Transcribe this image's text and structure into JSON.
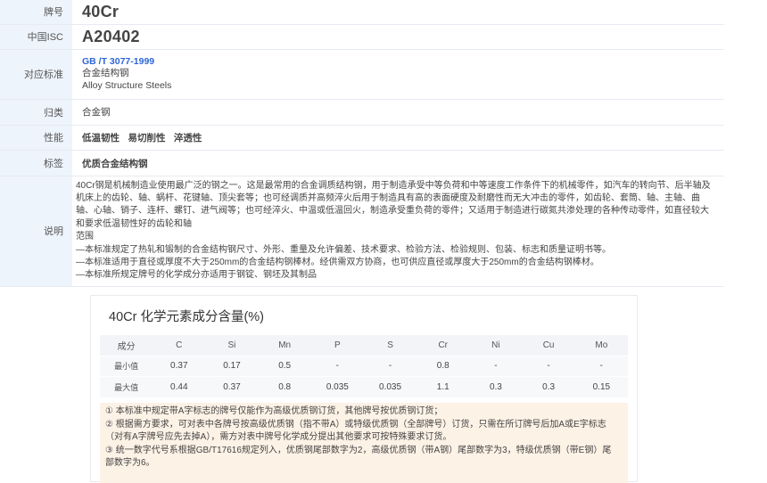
{
  "spec": {
    "grade_label": "牌号",
    "grade_value": "40Cr",
    "isc_label": "中国ISC",
    "isc_value": "A20402",
    "standard_label": "对应标准",
    "standard_code": "GB /T 3077-1999",
    "standard_cn": "合金结构钢",
    "standard_en": "Alloy Structure Steels",
    "category_label": "归类",
    "category_value": "合金钢",
    "property_label": "性能",
    "properties": [
      "低温韧性",
      "易切削性",
      "淬透性"
    ],
    "tag_label": "标签",
    "tags": [
      "优质合金结构钢"
    ],
    "desc_label": "说明",
    "desc_lines": [
      "40Cr钢是机械制造业使用最广泛的钢之一。这是最常用的合金调质结构钢，用于制造承受中等负荷和中等速度工作条件下的机械零件，如汽车的转向节、后半轴及",
      "机床上的齿轮、轴、蜗杆、花键轴、顶尖套等；也可经调质并高频淬火后用于制造具有高的表面硬度及耐磨性而无大冲击的零件，如齿轮、套筒、轴、主轴、曲",
      "轴、心轴、销子、连杆、螺钉、进气阀等；也可经淬火、中温或低温回火，制造承受重负荷的零件；又适用于制造进行碳氮共渗处理的各种传动零件，如直径较大",
      "和要求低温韧性好的齿轮和轴",
      "范围",
      "—本标准规定了热轧和锻制的合金结构钢尺寸、外形、重量及允许偏差、技术要求、检验方法、检验规则、包装、标志和质量证明书等。",
      "—本标准适用于直径或厚度不大于250mm的合金结构钢棒材。经供需双方协商，也可供应直径或厚度大于250mm的合金结构钢棒材。",
      "—本标准所规定牌号的化学成分亦适用于钢锭、钢坯及其制品"
    ]
  },
  "composition": {
    "title": "40Cr 化学元素成分含量(%)",
    "header": [
      "成分",
      "C",
      "Si",
      "Mn",
      "P",
      "S",
      "Cr",
      "Ni",
      "Cu",
      "Mo"
    ],
    "rows": [
      [
        "最小值",
        "0.37",
        "0.17",
        "0.5",
        "-",
        "-",
        "0.8",
        "-",
        "-",
        "-"
      ],
      [
        "最大值",
        "0.44",
        "0.37",
        "0.8",
        "0.035",
        "0.035",
        "1.1",
        "0.3",
        "0.3",
        "0.15"
      ]
    ],
    "notes": [
      "① 本标准中规定带A字标志的牌号仅能作为高级优质钢订货，其他牌号按优质钢订货；",
      "② 根据需方要求，可对表中各牌号按高级优质钢（指不带A）或特级优质钢（全部牌号）订货，只需在所订牌号后加A或E字标志",
      "（对有A字牌号应先去掉A），需方对表中牌号化学成分提出其他要求可按特殊要求订货。",
      "③ 统一数字代号系根据GB/T17616规定列入，优质钢尾部数字为2，高级优质钢（带A钢）尾部数字为3，特级优质钢（带E钢）尾",
      "部数字为6。"
    ]
  }
}
